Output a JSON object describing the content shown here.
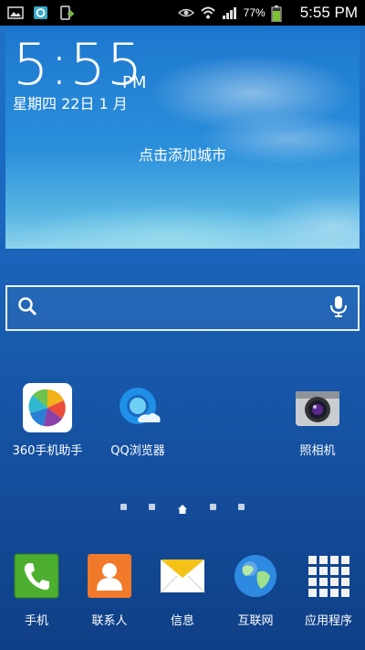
{
  "status_bar": {
    "battery_percent": "77%",
    "time": "5:55 PM"
  },
  "widget": {
    "time": "5:55",
    "ampm": "PM",
    "date": "星期四 22日 1 月",
    "city_prompt": "点击添加城市"
  },
  "search": {
    "placeholder": ""
  },
  "apps": [
    {
      "label": "360手机助手",
      "icon": "360-assistant-icon"
    },
    {
      "label": "QQ浏览器",
      "icon": "qq-browser-icon"
    },
    {
      "label": "照相机",
      "icon": "camera-icon"
    }
  ],
  "dock": [
    {
      "label": "手机",
      "icon": "phone-icon"
    },
    {
      "label": "联系人",
      "icon": "contacts-icon"
    },
    {
      "label": "信息",
      "icon": "messages-icon"
    },
    {
      "label": "互联网",
      "icon": "internet-icon"
    },
    {
      "label": "应用程序",
      "icon": "apps-grid-icon"
    }
  ],
  "colors": {
    "accent": "#1f72c9",
    "battery": "#7ec234"
  }
}
